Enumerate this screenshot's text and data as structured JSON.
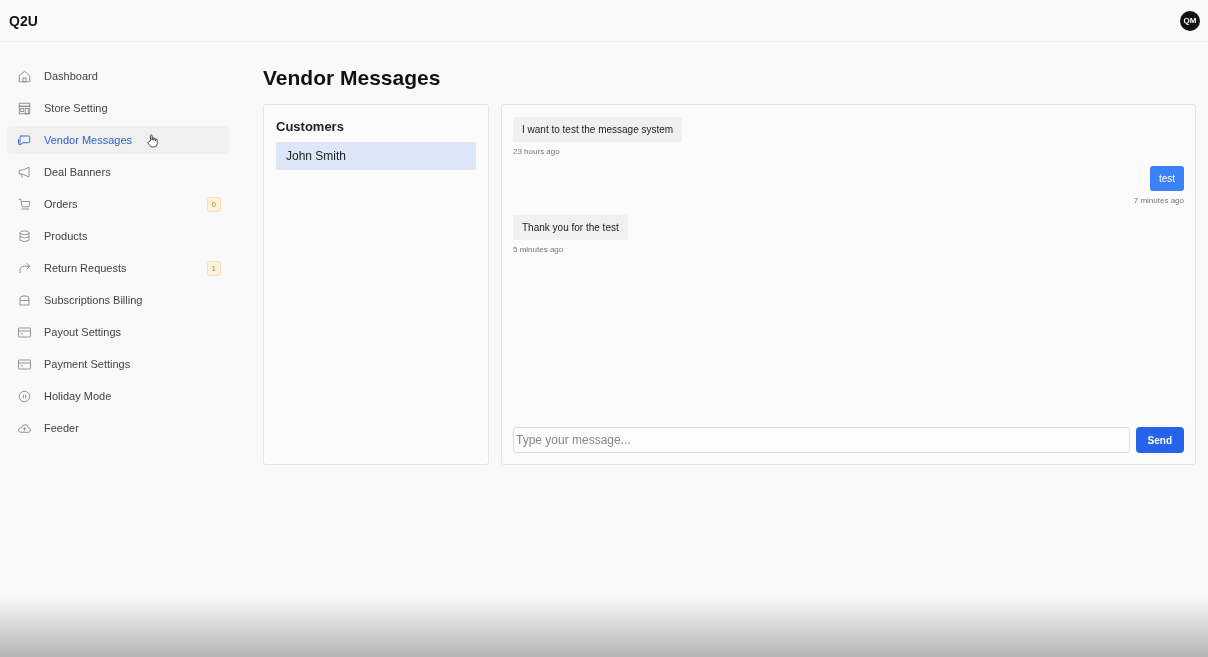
{
  "header": {
    "logo": "Q2U",
    "avatar": "QM"
  },
  "sidebar": {
    "items": [
      {
        "label": "Dashboard",
        "selected": false
      },
      {
        "label": "Store Setting",
        "selected": false
      },
      {
        "label": "Vendor Messages",
        "selected": true
      },
      {
        "label": "Deal Banners",
        "selected": false
      },
      {
        "label": "Orders",
        "selected": false,
        "badge": "0"
      },
      {
        "label": "Products",
        "selected": false
      },
      {
        "label": "Return Requests",
        "selected": false,
        "badge": "1"
      },
      {
        "label": "Subscriptions Billing",
        "selected": false
      },
      {
        "label": "Payout Settings",
        "selected": false
      },
      {
        "label": "Payment Settings",
        "selected": false
      },
      {
        "label": "Holiday Mode",
        "selected": false
      },
      {
        "label": "Feeder",
        "selected": false
      }
    ]
  },
  "page_title": "Vendor Messages",
  "customers": {
    "heading": "Customers",
    "items": [
      {
        "name": "John Smith",
        "selected": true
      }
    ]
  },
  "chat": {
    "messages": [
      {
        "kind": "received",
        "text": "I want to test the message system",
        "time": "23 hours ago"
      },
      {
        "kind": "sent",
        "text": "test",
        "time": "7 minutes ago"
      },
      {
        "kind": "received",
        "text": "Thank you for the test",
        "time": "5 minutes ago"
      }
    ],
    "input": {
      "placeholder": "Type your message..."
    },
    "send_button": "Send"
  }
}
